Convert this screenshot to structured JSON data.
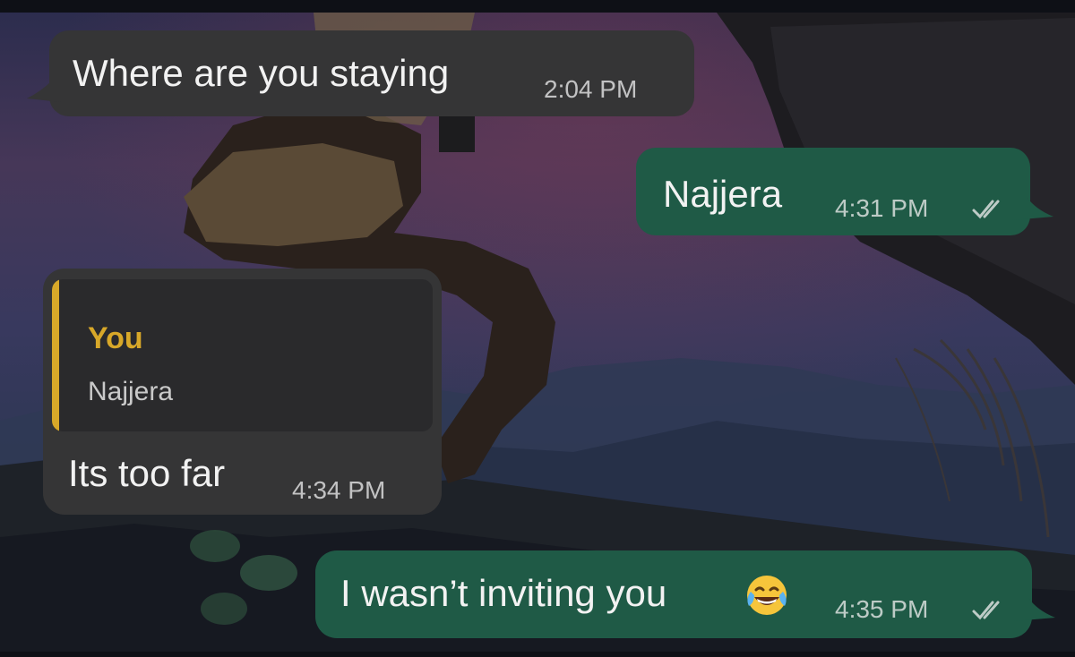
{
  "conversation": {
    "messages": [
      {
        "direction": "incoming",
        "text": "Where are you staying",
        "time": "2:04 PM"
      },
      {
        "direction": "outgoing",
        "text": "Najjera",
        "time": "4:31 PM",
        "read_receipt": "double-check-icon"
      },
      {
        "direction": "incoming",
        "reply_to": {
          "author": "You",
          "text": "Najjera"
        },
        "text": "Its too far",
        "time": "4:34 PM"
      },
      {
        "direction": "outgoing",
        "text": "I wasn’t inviting you",
        "emoji": "face-with-tears-of-joy",
        "time": "4:35 PM",
        "read_receipt": "double-check-icon"
      }
    ]
  },
  "colors": {
    "incoming_bubble": "#353536",
    "outgoing_bubble": "#1f5a46",
    "quote_accent": "#d8a829"
  }
}
